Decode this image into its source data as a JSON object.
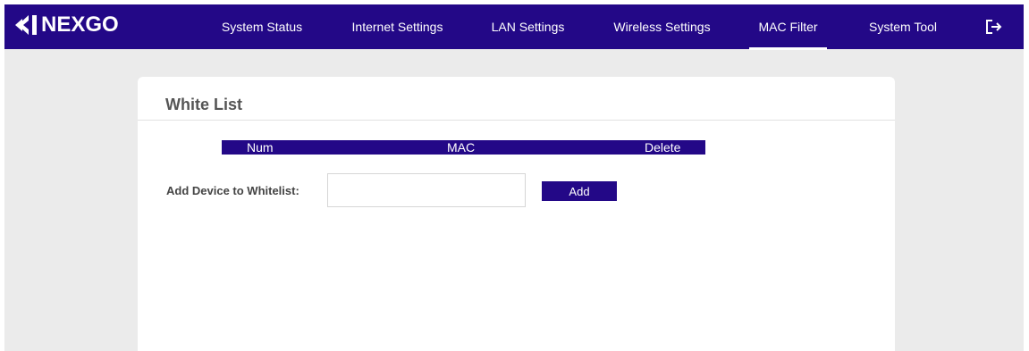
{
  "brand": {
    "name": "NEXGO"
  },
  "nav": {
    "items": [
      {
        "label": "System Status"
      },
      {
        "label": "Internet Settings"
      },
      {
        "label": "LAN Settings"
      },
      {
        "label": "Wireless Settings"
      },
      {
        "label": "MAC Filter",
        "active": true
      },
      {
        "label": "System Tool"
      }
    ],
    "logout_icon": "logout-icon"
  },
  "panel": {
    "title": "White List",
    "table": {
      "columns": [
        "Num",
        "MAC",
        "Delete"
      ],
      "rows": []
    },
    "add_device": {
      "label": "Add Device to Whitelist:",
      "input_value": "",
      "button_label": "Add"
    }
  },
  "colors": {
    "brand_primary": "#230887",
    "page_background": "#ebebeb",
    "panel_background": "#ffffff"
  }
}
